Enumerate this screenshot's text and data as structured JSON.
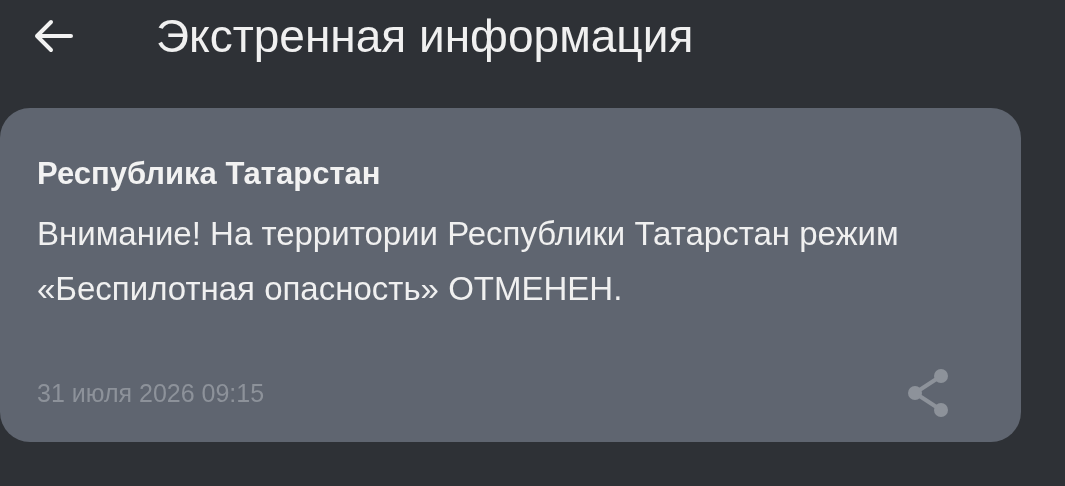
{
  "header": {
    "title": "Экстренная информация"
  },
  "message": {
    "sender": "Республика Татарстан",
    "text": "Внимание! На территории Республики Татарстан режим «Беспилотная опасность» ОТМЕНЕН.",
    "timestamp": "31 июля 2026 09:15"
  }
}
